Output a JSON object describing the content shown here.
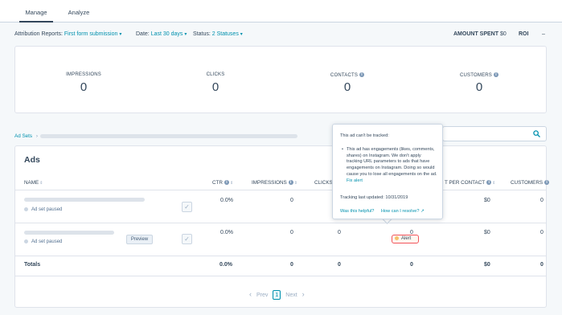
{
  "tabs": [
    {
      "label": "Manage"
    },
    {
      "label": "Analyze"
    }
  ],
  "filters": {
    "attribution_label": "Attribution Reports:",
    "attribution_value": "First form submission",
    "date_label": "Date:",
    "date_value": "Last 30 days",
    "status_label": "Status:",
    "status_value": "2 Statuses",
    "amount_spent_label": "AMOUNT SPENT",
    "amount_spent_value": "$0",
    "roi_label": "ROI",
    "roi_value": "–"
  },
  "kpis": [
    {
      "label": "IMPRESSIONS",
      "value": "0"
    },
    {
      "label": "CLICKS",
      "value": "0"
    },
    {
      "label": "CONTACTS",
      "value": "0"
    },
    {
      "label": "CUSTOMERS",
      "value": "0"
    }
  ],
  "breadcrumb": {
    "label": "Ad Sets",
    "sep": "›"
  },
  "table": {
    "title": "Ads",
    "columns": [
      "NAME",
      "CTR",
      "IMPRESSIONS",
      "CLICKS",
      "T PER CONTACT",
      "CUSTOMERS"
    ],
    "rows": [
      {
        "status": "Ad set paused",
        "ctr": "0.0%",
        "impressions": "0",
        "clicks": "",
        "contacts": "",
        "cost_per_contact": "$0",
        "customers": "0",
        "preview": ""
      },
      {
        "status": "Ad set paused",
        "ctr": "0.0%",
        "impressions": "0",
        "clicks": "0",
        "contacts": "0",
        "cost_per_contact": "$0",
        "customers": "0",
        "preview": "Preview"
      }
    ],
    "totals": {
      "label": "Totals",
      "ctr": "0.0%",
      "impressions": "0",
      "clicks": "0",
      "contacts": "0",
      "cost_per_contact": "$0",
      "customers": "0"
    }
  },
  "alert_badge": "Alert",
  "tooltip": {
    "title": "This ad can't be tracked:",
    "bullet": "This ad has engagements (likes, comments, shares) on Instagram. We don't apply tracking URL parameters to ads that have engagements on Instagram. Doing so would cause you to lose all engagements on the ad.",
    "fix_link": "Fix alert",
    "updated": "Tracking last updated: 10/31/2019",
    "helpful": "Was this helpful?",
    "resolve": "How can I resolve?"
  },
  "pagination": {
    "prev": "Prev",
    "page": "1",
    "next": "Next"
  },
  "colors": {
    "accent": "#0091ae",
    "alert_border": "#f2545b",
    "alert_dot": "#f5c26b"
  }
}
